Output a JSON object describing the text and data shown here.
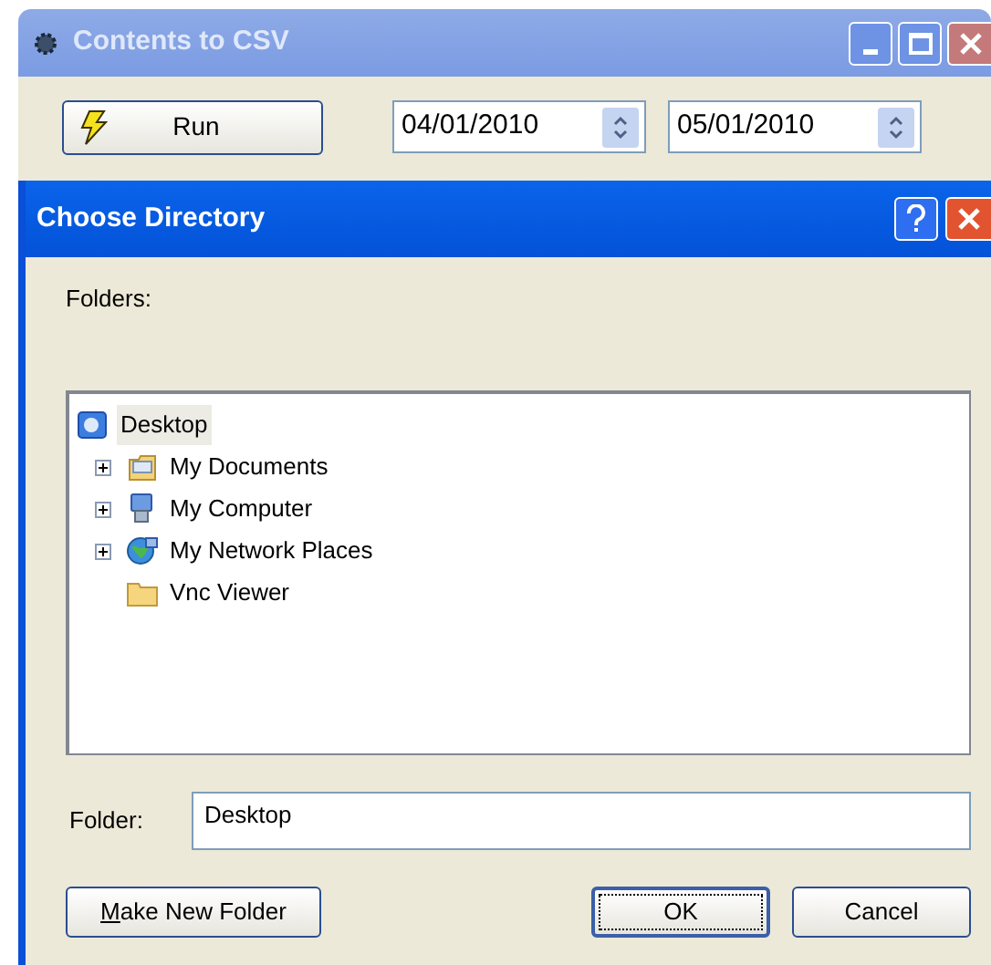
{
  "main_window": {
    "title": "Contents to CSV",
    "active": false
  },
  "toolbar": {
    "run_button": "Run",
    "date_fields": [
      {
        "value": "04/01/2010"
      },
      {
        "value": "05/01/2010"
      }
    ]
  },
  "dialog": {
    "title": "Choose Directory",
    "active": true,
    "folders_label": "Folders:",
    "tree": {
      "label": "Desktop",
      "selected": true,
      "children": [
        {
          "label": "My Documents",
          "selected": false,
          "has_children": true
        },
        {
          "label": "My Computer",
          "selected": false,
          "has_children": true
        },
        {
          "label": "My Network Places",
          "selected": false,
          "has_children": true
        },
        {
          "label": "Vnc Viewer",
          "selected": false,
          "has_children": false
        }
      ]
    },
    "folder_label": "Folder:",
    "folder_value": "Desktop",
    "buttons": [
      {
        "label": "Make New Folder",
        "kind": "left",
        "default": false
      },
      {
        "label": "OK",
        "kind": "right",
        "default": true
      },
      {
        "label": "Cancel",
        "kind": "right",
        "default": false
      }
    ]
  }
}
